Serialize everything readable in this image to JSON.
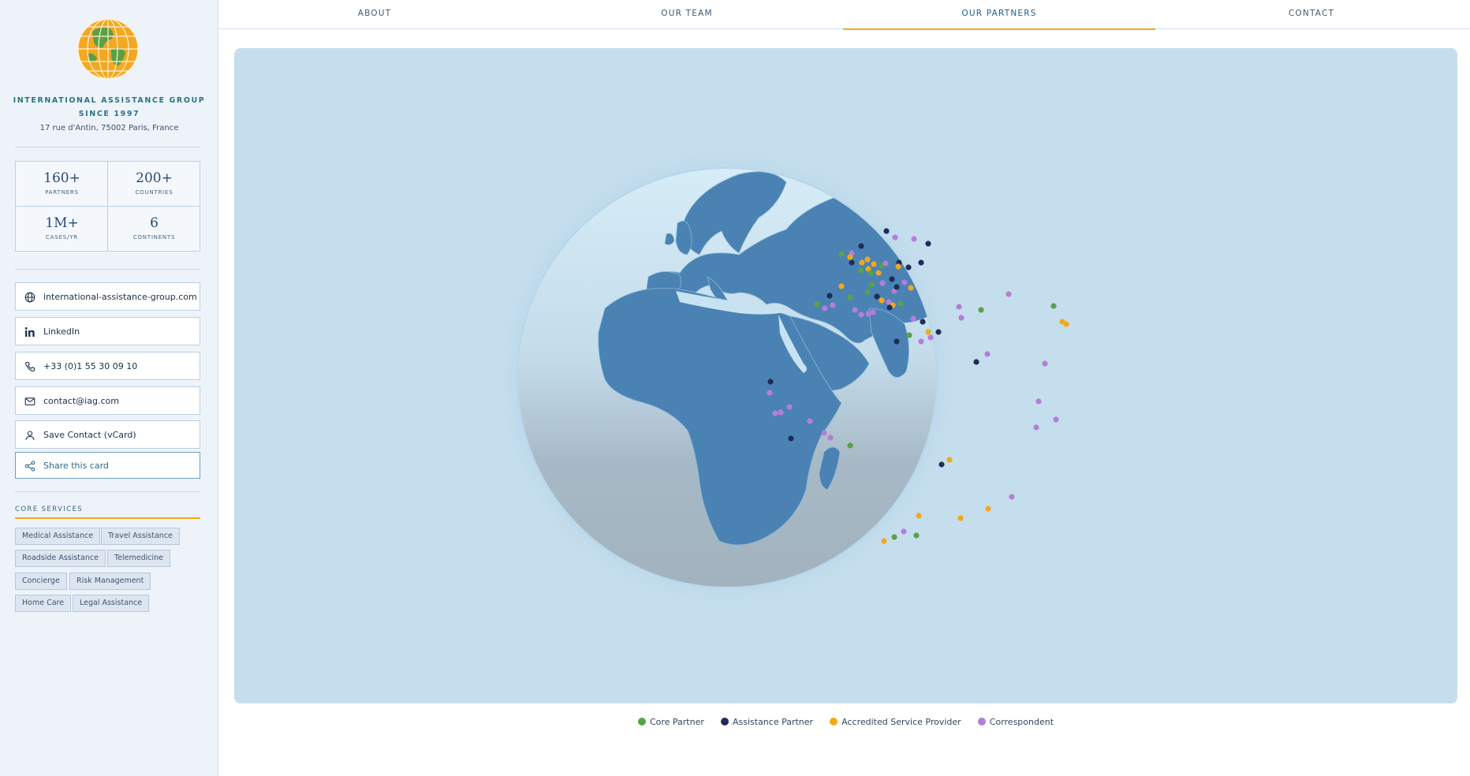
{
  "org": {
    "name": "INTERNATIONAL ASSISTANCE GROUP",
    "since": "SINCE 1997",
    "address": "17 rue d'Antin, 75002 Paris, France"
  },
  "stats": [
    {
      "value": "160+",
      "label": "PARTNERS"
    },
    {
      "value": "200+",
      "label": "COUNTRIES"
    },
    {
      "value": "1M+",
      "label": "CASES/YR"
    },
    {
      "value": "6",
      "label": "CONTINENTS"
    }
  ],
  "contacts": {
    "website": "international-assistance-group.com",
    "linkedin": "LinkedIn",
    "phone": "+33 (0)1 55 30 09 10",
    "email": "contact@iag.com",
    "vcard": "Save Contact (vCard)",
    "share": "Share this card"
  },
  "services": {
    "title": "CORE SERVICES",
    "tags": [
      "Medical Assistance",
      "Travel Assistance",
      "Roadside Assistance",
      "Telemedicine",
      "Concierge",
      "Risk Management",
      "Home Care",
      "Legal Assistance"
    ]
  },
  "nav": {
    "tabs": [
      "ABOUT",
      "OUR TEAM",
      "OUR PARTNERS",
      "CONTACT"
    ],
    "active": "OUR PARTNERS"
  },
  "legend": [
    {
      "label": "Core Partner",
      "color": "#5aa14a"
    },
    {
      "label": "Assistance Partner",
      "color": "#1f2c5a"
    },
    {
      "label": "Accredited Service Provider",
      "color": "#f2a81d"
    },
    {
      "label": "Correspondent",
      "color": "#b57ed6"
    }
  ],
  "colors": {
    "land": "#4a82b4",
    "ocean": "#c7e2f1",
    "accent": "#f2a81d"
  }
}
